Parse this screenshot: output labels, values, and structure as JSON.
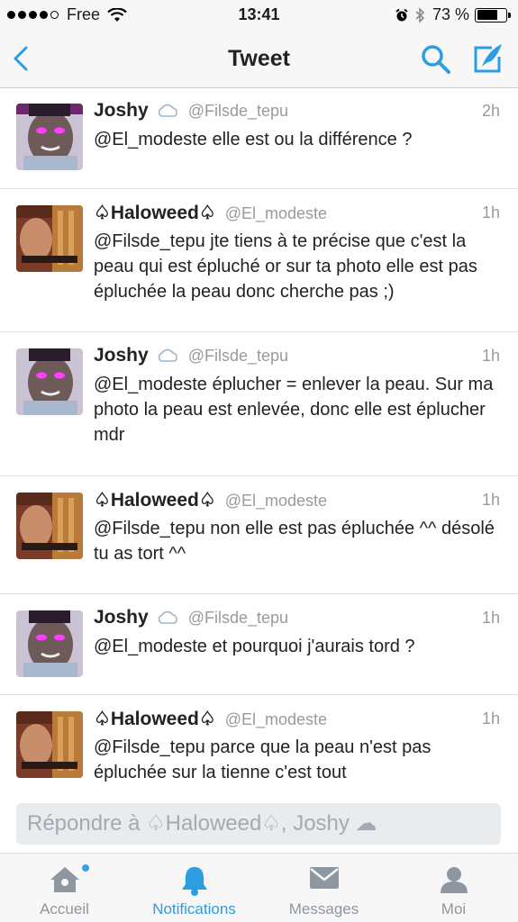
{
  "status_bar": {
    "carrier": "Free",
    "time": "13:41",
    "battery": "73 %",
    "battery_level": 0.73
  },
  "nav": {
    "title": "Tweet",
    "accent_color": "#2b9de0"
  },
  "tweets": [
    {
      "name": "Joshy",
      "handle": "@Filsde_tepu",
      "time": "2h",
      "text": "@El_modeste elle est ou la différence ?"
    },
    {
      "name": "♤Haloweed♤",
      "handle": "@El_modeste",
      "time": "1h",
      "text": "@Filsde_tepu jte tiens à te précise que c'est la peau qui est épluché or sur ta photo elle est pas épluchée la peau donc cherche pas ;)"
    },
    {
      "name": "Joshy",
      "handle": "@Filsde_tepu",
      "time": "1h",
      "text": "@El_modeste éplucher = enlever la peau. Sur ma photo la peau est enlevée, donc elle est éplucher mdr"
    },
    {
      "name": "♤Haloweed♤",
      "handle": "@El_modeste",
      "time": "1h",
      "text": "@Filsde_tepu non elle est pas épluchée ^^ désolé tu as tort ^^"
    },
    {
      "name": "Joshy",
      "handle": "@Filsde_tepu",
      "time": "1h",
      "text": "@El_modeste et pourquoi j'aurais tord ?"
    },
    {
      "name": "♤Haloweed♤",
      "handle": "@El_modeste",
      "time": "1h",
      "text": "@Filsde_tepu parce que la peau n'est pas épluchée sur la tienne c'est tout"
    }
  ],
  "reply": {
    "placeholder": "Répondre à ♤Haloweed♤, Joshy ☁"
  },
  "tabs": [
    {
      "label": "Accueil",
      "icon": "home-icon",
      "active": false
    },
    {
      "label": "Notifications",
      "icon": "bell-icon",
      "active": true
    },
    {
      "label": "Messages",
      "icon": "envelope-icon",
      "active": false
    },
    {
      "label": "Moi",
      "icon": "person-icon",
      "active": false
    }
  ]
}
